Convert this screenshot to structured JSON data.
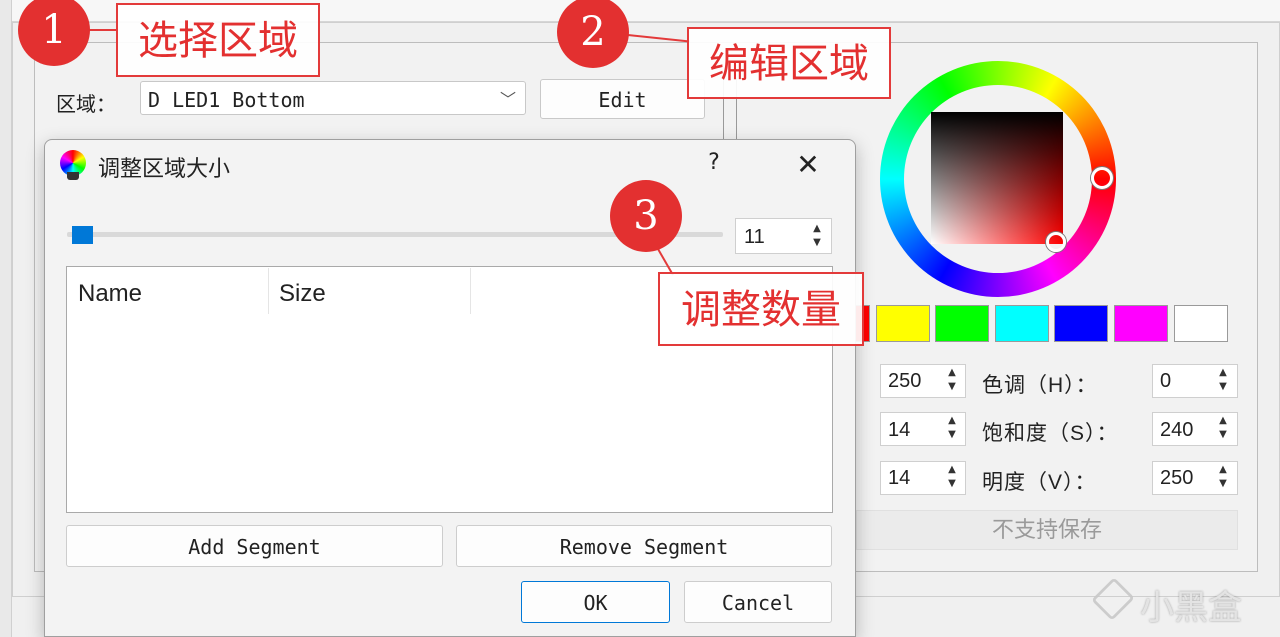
{
  "main": {
    "zone_label": "区域：",
    "zone_select_value": "D LED1 Bottom",
    "edit_label": "Edit"
  },
  "color_panel": {
    "swatches": [
      "#ff0000",
      "#ffff00",
      "#00ff00",
      "#00ffff",
      "#0000ff",
      "#ff00ff",
      "#ffffff"
    ],
    "rows": [
      {
        "left_value": "250",
        "label": "色调（H）：",
        "right_value": "0"
      },
      {
        "left_value": "14",
        "label": "饱和度（S）：",
        "right_value": "240"
      },
      {
        "left_value": "14",
        "label": "明度（V）：",
        "right_value": "250"
      }
    ],
    "save_label": "不支持保存"
  },
  "dialog": {
    "title": "调整区域大小",
    "help_label": "?",
    "close_label": "✕",
    "segment_count": "11",
    "columns": [
      "Name",
      "Size"
    ],
    "add_segment_label": "Add Segment",
    "remove_segment_label": "Remove Segment",
    "ok_label": "OK",
    "cancel_label": "Cancel"
  },
  "annotations": [
    {
      "number": "1",
      "text": "选择区域"
    },
    {
      "number": "2",
      "text": "编辑区域"
    },
    {
      "number": "3",
      "text": "调整数量"
    }
  ],
  "watermark": {
    "text": "小黑盒"
  },
  "colors": {
    "accent": "#0078d7",
    "annotation_red": "#e33030"
  }
}
